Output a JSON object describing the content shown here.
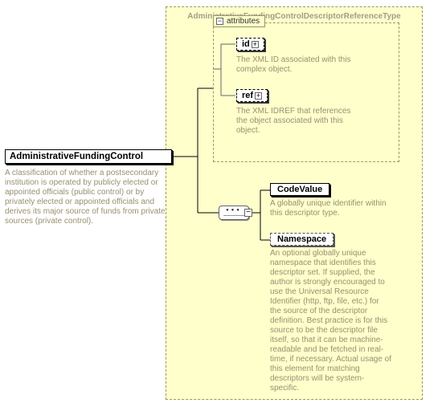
{
  "type": {
    "title": "AdministrativeFundingControlDescriptorReferenceType"
  },
  "root": {
    "label": "AdministrativeFundingControl",
    "description": "A classification of whether a postsecondary institution is operated by publicly elected or appointed officials (public control) or by privately elected or appointed officials and derives its major source of funds from private sources (private control)."
  },
  "attributes": {
    "tab": "attributes",
    "items": [
      {
        "name": "id",
        "description": "The XML ID associated with this complex object."
      },
      {
        "name": "ref",
        "description": "The XML IDREF that references the object associated with this object."
      }
    ]
  },
  "children": [
    {
      "name": "CodeValue",
      "optional": false,
      "description": "A globally unique identifier within this descriptor type."
    },
    {
      "name": "Namespace",
      "optional": true,
      "description": "An optional globally unique namespace that identifies this descriptor set. If supplied, the author is strongly encouraged to use the Universal Resource Identifier (http, ftp, file, etc.) for the source of the descriptor definition. Best practice is for this source to be the descriptor file itself, so that it can be machine-readable and be fetched in real-time, if necessary. Actual usage of this element for matching descriptors will be system-specific."
    }
  ]
}
